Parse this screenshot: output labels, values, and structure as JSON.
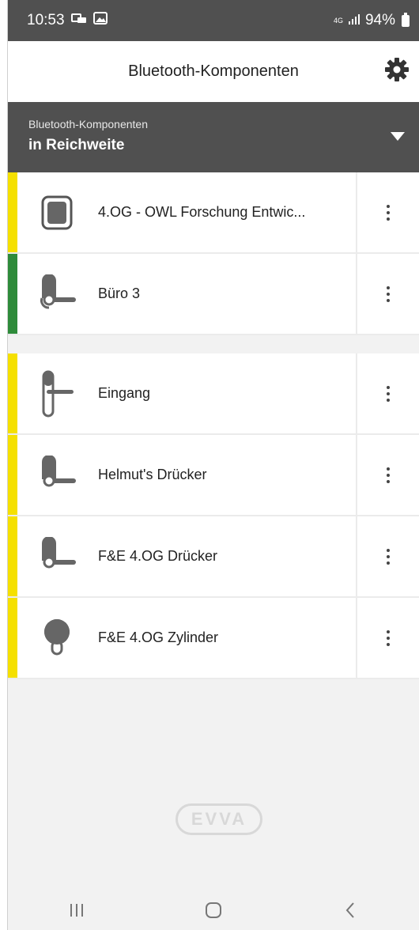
{
  "status_bar": {
    "time": "10:53",
    "network": "4G",
    "battery": "94%"
  },
  "header": {
    "title": "Bluetooth-Komponenten",
    "settings_icon": "gear-icon"
  },
  "filter": {
    "label": "Bluetooth-Komponenten",
    "value": "in Reichweite"
  },
  "colors": {
    "yellow": "#f5e000",
    "green": "#2e8b3a",
    "dark": "#505050"
  },
  "group_one": [
    {
      "label": "4.OG - OWL Forschung Entwic...",
      "icon": "wall-reader-icon",
      "status_color": "#f5e000"
    },
    {
      "label": "Büro 3",
      "icon": "door-handle-icon",
      "status_color": "#2e8b3a"
    }
  ],
  "group_two": [
    {
      "label": "Eingang",
      "icon": "long-plate-handle-icon",
      "status_color": "#f5e000"
    },
    {
      "label": "Helmut's Drücker",
      "icon": "door-handle-icon",
      "status_color": "#f5e000"
    },
    {
      "label": "F&E 4.OG Drücker",
      "icon": "door-handle-icon",
      "status_color": "#f5e000"
    },
    {
      "label": "F&E 4.OG Zylinder",
      "icon": "cylinder-icon",
      "status_color": "#f5e000"
    }
  ],
  "logo": "EVVA"
}
